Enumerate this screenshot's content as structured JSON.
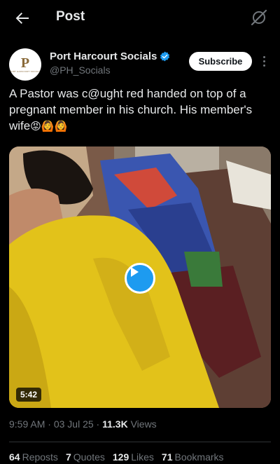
{
  "header": {
    "title": "Post",
    "back_icon": "arrow-left-icon",
    "grok_icon": "grok-icon"
  },
  "author": {
    "avatar_monogram": "P",
    "avatar_subtext": "PORT HARCOURT SOCIALS",
    "display_name": "Port Harcourt Socials",
    "handle": "@PH_Socials",
    "verified": true,
    "subscribe_label": "Subscribe",
    "more_icon": "more-vertical-icon"
  },
  "tweet": {
    "text": "A Pastor was c@ught red handed on top of a pregnant member in his church. His member's wife",
    "emojis": "😡🙆🙆"
  },
  "media": {
    "type": "video",
    "duration": "5:42",
    "play_icon": "play-icon"
  },
  "meta": {
    "time": "9:59 AM",
    "separator": "·",
    "date": "03 Jul 25",
    "views_count": "11.3K",
    "views_label": "Views"
  },
  "stats": {
    "reposts_count": "64",
    "reposts_label": "Reposts",
    "quotes_count": "7",
    "quotes_label": "Quotes",
    "likes_count": "129",
    "likes_label": "Likes",
    "bookmarks_count": "71",
    "bookmarks_label": "Bookmarks"
  },
  "colors": {
    "background": "#000000",
    "text_primary": "#e7e9ea",
    "text_secondary": "#71767b",
    "accent": "#1d9bf0",
    "divider": "#2f3336"
  }
}
